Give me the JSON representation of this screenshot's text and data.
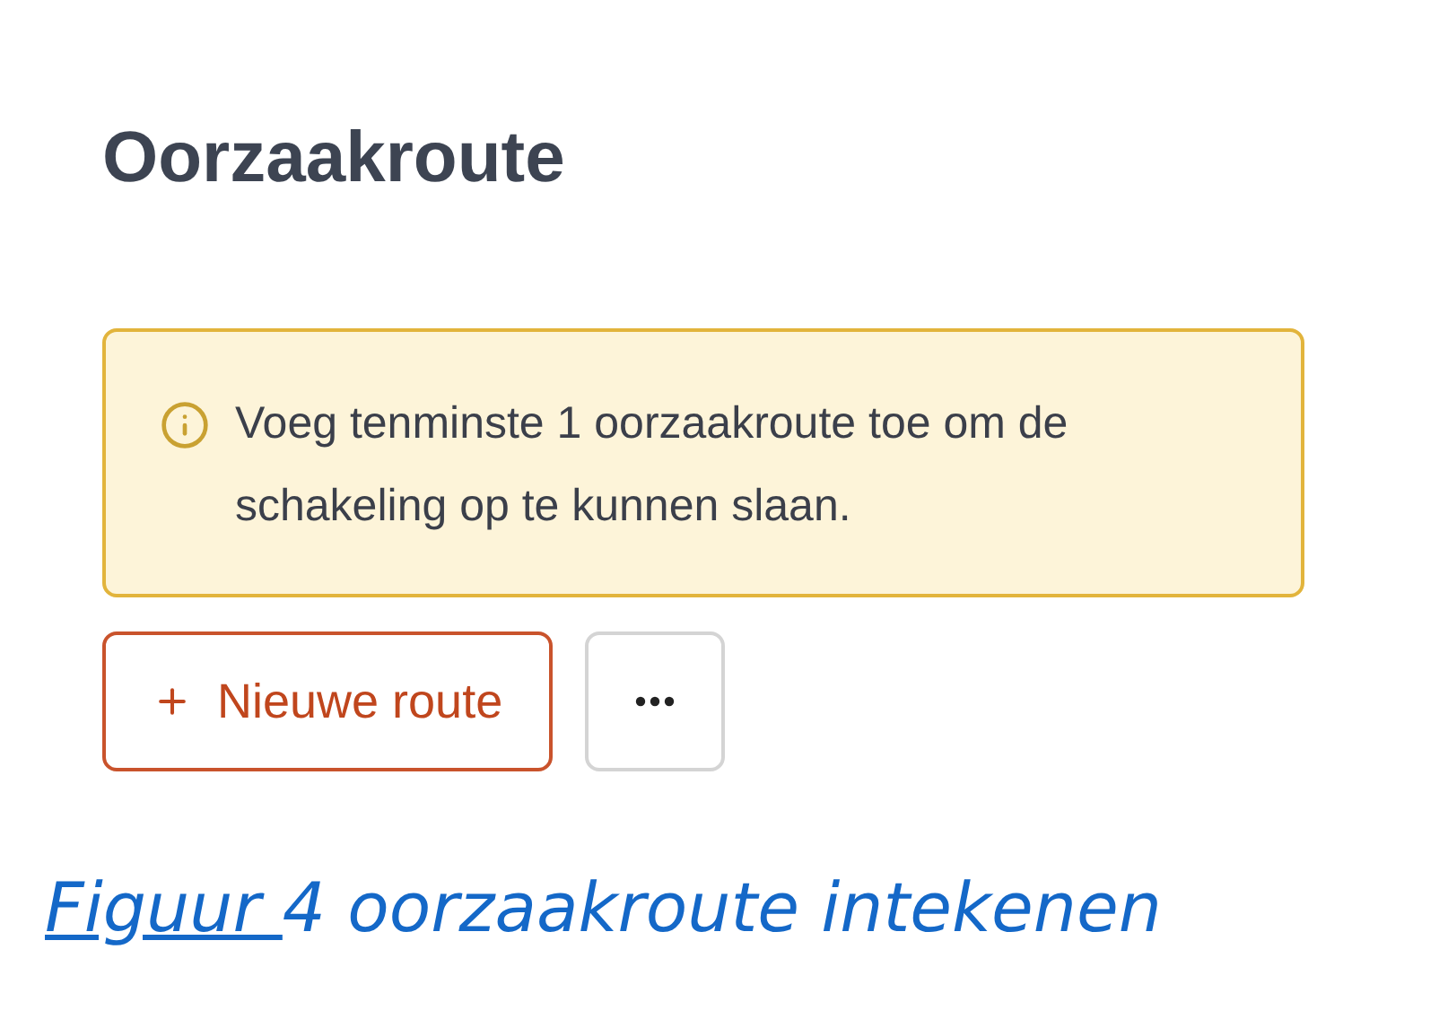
{
  "title": "Oorzaakroute",
  "alert": {
    "kind": "warning",
    "text": "Voeg tenminste 1 oorzaakroute toe om de schakeling op te kunnen slaan."
  },
  "buttons": [
    {
      "kind": "outline",
      "label": "Nieuwe route"
    },
    {
      "kind": "more"
    }
  ],
  "caption": {
    "link": "Figuur ",
    "text": "4 oorzaakroute intekenen"
  }
}
